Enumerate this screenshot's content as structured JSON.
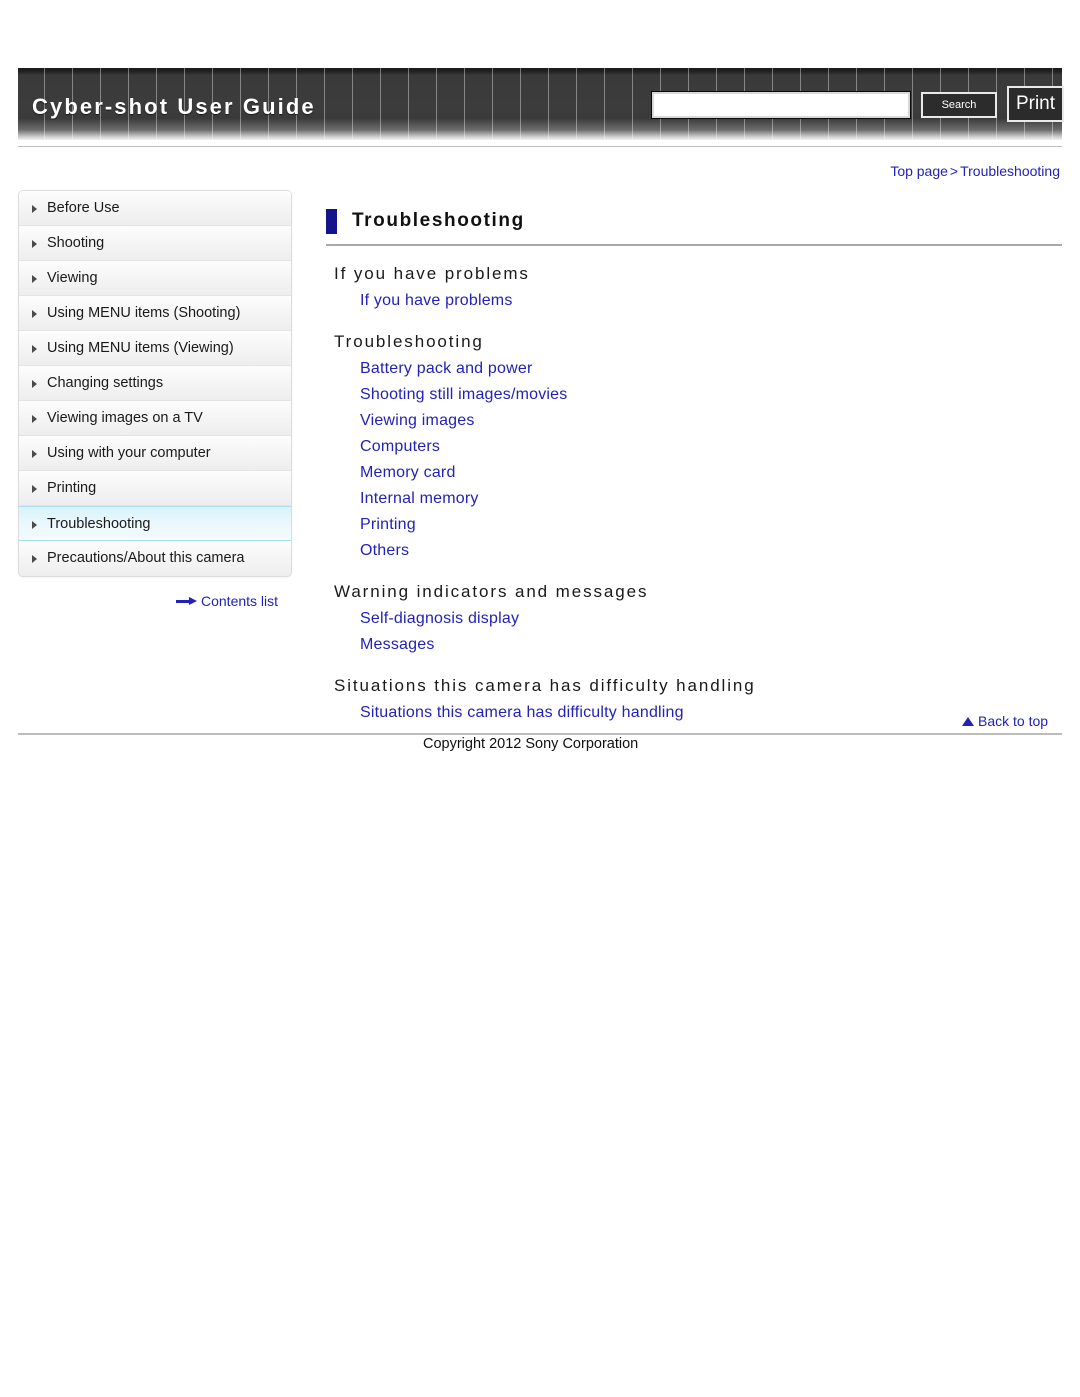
{
  "header": {
    "title": "Cyber-shot User Guide",
    "search_value": "",
    "search_placeholder": "",
    "search_button_label": "Search",
    "print_button_label": "Print"
  },
  "breadcrumb": {
    "top_page": "Top page",
    "separator": ">",
    "current": "Troubleshooting"
  },
  "sidebar": {
    "items": [
      {
        "label": "Before Use",
        "active": false
      },
      {
        "label": "Shooting",
        "active": false
      },
      {
        "label": "Viewing",
        "active": false
      },
      {
        "label": "Using MENU items (Shooting)",
        "active": false
      },
      {
        "label": "Using MENU items (Viewing)",
        "active": false
      },
      {
        "label": "Changing settings",
        "active": false
      },
      {
        "label": "Viewing images on a TV",
        "active": false
      },
      {
        "label": "Using with your computer",
        "active": false
      },
      {
        "label": "Printing",
        "active": false
      },
      {
        "label": "Troubleshooting",
        "active": true
      },
      {
        "label": "Precautions/About this camera",
        "active": false
      }
    ],
    "contents_list_label": "Contents list"
  },
  "main": {
    "page_title": "Troubleshooting",
    "sections": [
      {
        "heading": "If you have problems",
        "links": [
          "If you have problems"
        ]
      },
      {
        "heading": "Troubleshooting",
        "links": [
          "Battery pack and power",
          "Shooting still images/movies",
          "Viewing images",
          "Computers",
          "Memory card",
          "Internal memory",
          "Printing",
          "Others"
        ]
      },
      {
        "heading": "Warning indicators and messages",
        "links": [
          "Self-diagnosis display",
          "Messages"
        ]
      },
      {
        "heading": "Situations this camera has difficulty handling",
        "links": [
          "Situations this camera has difficulty handling"
        ]
      }
    ]
  },
  "footer": {
    "back_to_top_label": "Back to top",
    "copyright": "Copyright 2012 Sony Corporation"
  },
  "colors": {
    "link": "#2222bb",
    "title_accent": "#13138c",
    "active_nav_border": "#a8dcef"
  }
}
